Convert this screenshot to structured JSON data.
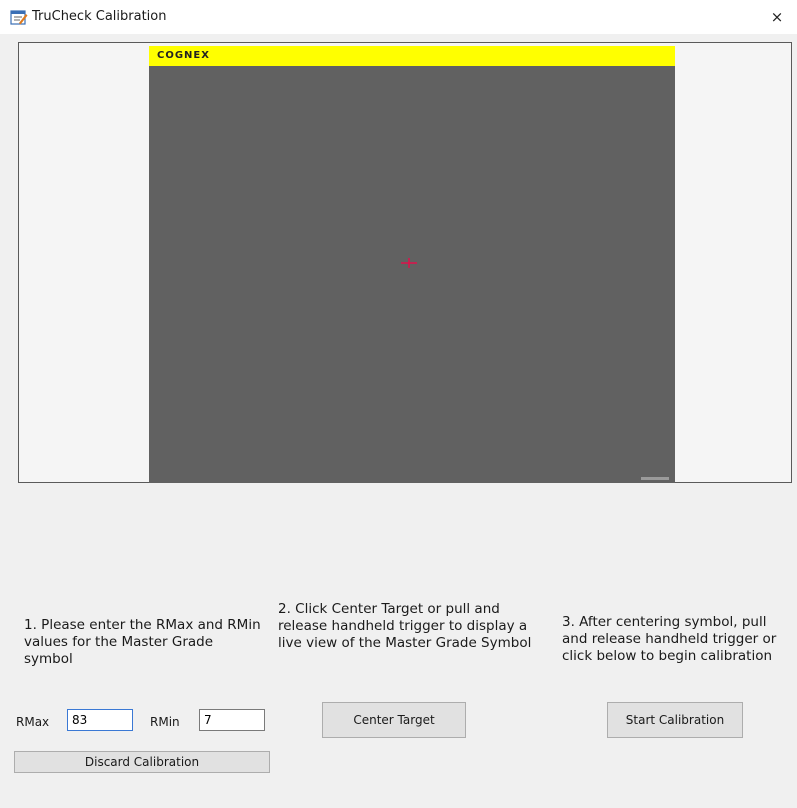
{
  "window": {
    "title": "TruCheck Calibration",
    "close_glyph": "×",
    "app_icon": "calibration-app-icon"
  },
  "viewer": {
    "brand": "COGNEX",
    "brand_bar_color": "#ffff00",
    "image_bg": "#616161",
    "crosshair_color": "#e0104a"
  },
  "instructions": {
    "step1": "1. Please enter the RMax and RMin values for the Master Grade symbol",
    "step2": "2. Click Center Target or pull and release handheld trigger to display a live view of the Master Grade Symbol",
    "step3": "3. After centering symbol, pull and release handheld trigger or click below to begin calibration"
  },
  "fields": {
    "rmax_label": "RMax",
    "rmax_value": "83",
    "rmin_label": "RMin",
    "rmin_value": "7"
  },
  "buttons": {
    "center_target": "Center Target",
    "start_calibration": "Start Calibration",
    "discard_calibration": "Discard Calibration"
  }
}
